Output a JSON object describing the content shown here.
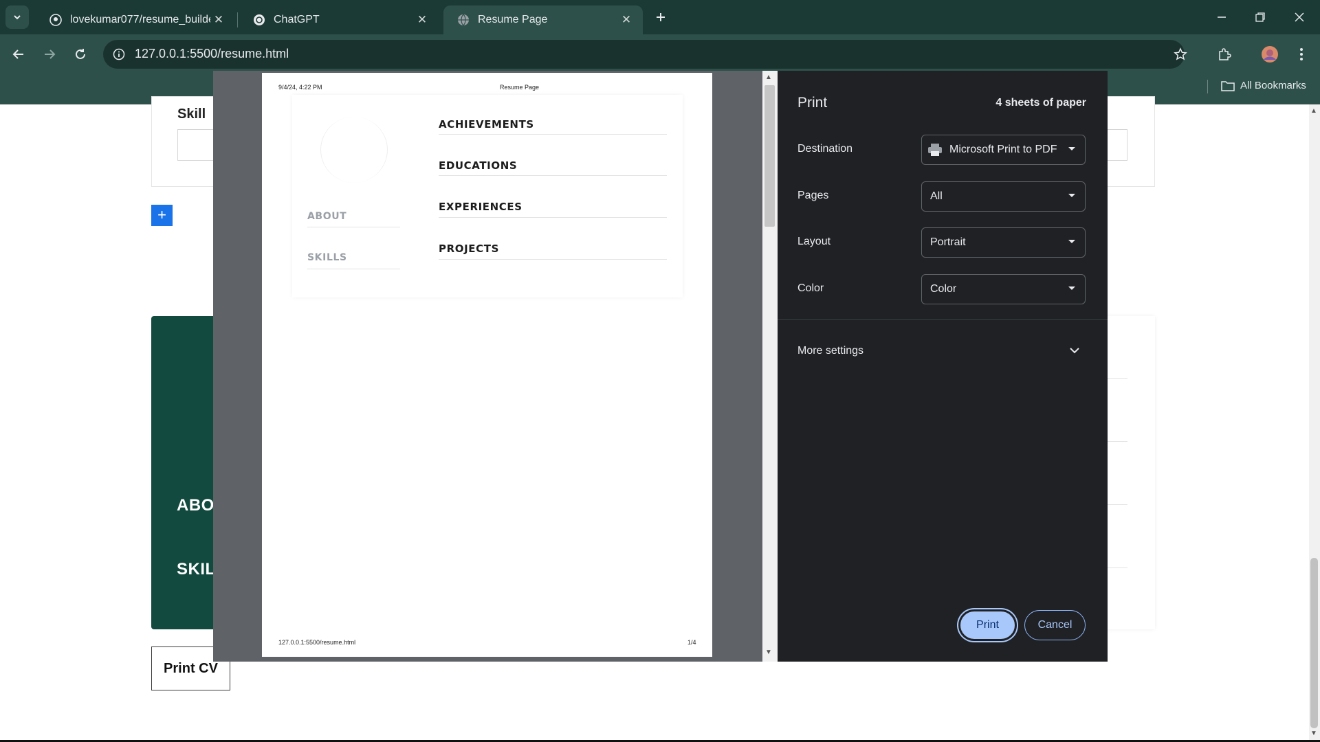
{
  "browser": {
    "tabs": [
      {
        "title": "lovekumar077/resume_builder",
        "icon": "github-icon",
        "active": false
      },
      {
        "title": "ChatGPT",
        "icon": "chatgpt-icon",
        "active": false
      },
      {
        "title": "Resume Page",
        "icon": "globe-icon",
        "active": true
      }
    ],
    "url": "127.0.0.1:5500/resume.html",
    "bookmarks_label": "All Bookmarks"
  },
  "page": {
    "skill_label": "Skill",
    "add_button": "+",
    "green_items": [
      "ABO",
      "SKIL"
    ],
    "print_cv": "Print CV"
  },
  "preview": {
    "header_date": "9/4/24, 4:22 PM",
    "header_title": "Resume Page",
    "footer_url": "127.0.0.1:5500/resume.html",
    "footer_page": "1/4",
    "right_sections": [
      "ACHIEVEMENTS",
      "EDUCATIONS",
      "EXPERIENCES",
      "PROJECTS"
    ],
    "left_sections": [
      "ABOUT",
      "SKILLS"
    ]
  },
  "print": {
    "title": "Print",
    "sheets": "4 sheets of paper",
    "destination_label": "Destination",
    "destination_value": "Microsoft Print to PDF",
    "pages_label": "Pages",
    "pages_value": "All",
    "layout_label": "Layout",
    "layout_value": "Portrait",
    "color_label": "Color",
    "color_value": "Color",
    "more_settings": "More settings",
    "print_button": "Print",
    "cancel_button": "Cancel"
  },
  "colors": {
    "tabstrip": "#1b3a35",
    "toolbar": "#2d504a",
    "dialog_bg": "#202124",
    "print_button": "#a8c7fa",
    "green_panel": "#124a3f"
  }
}
